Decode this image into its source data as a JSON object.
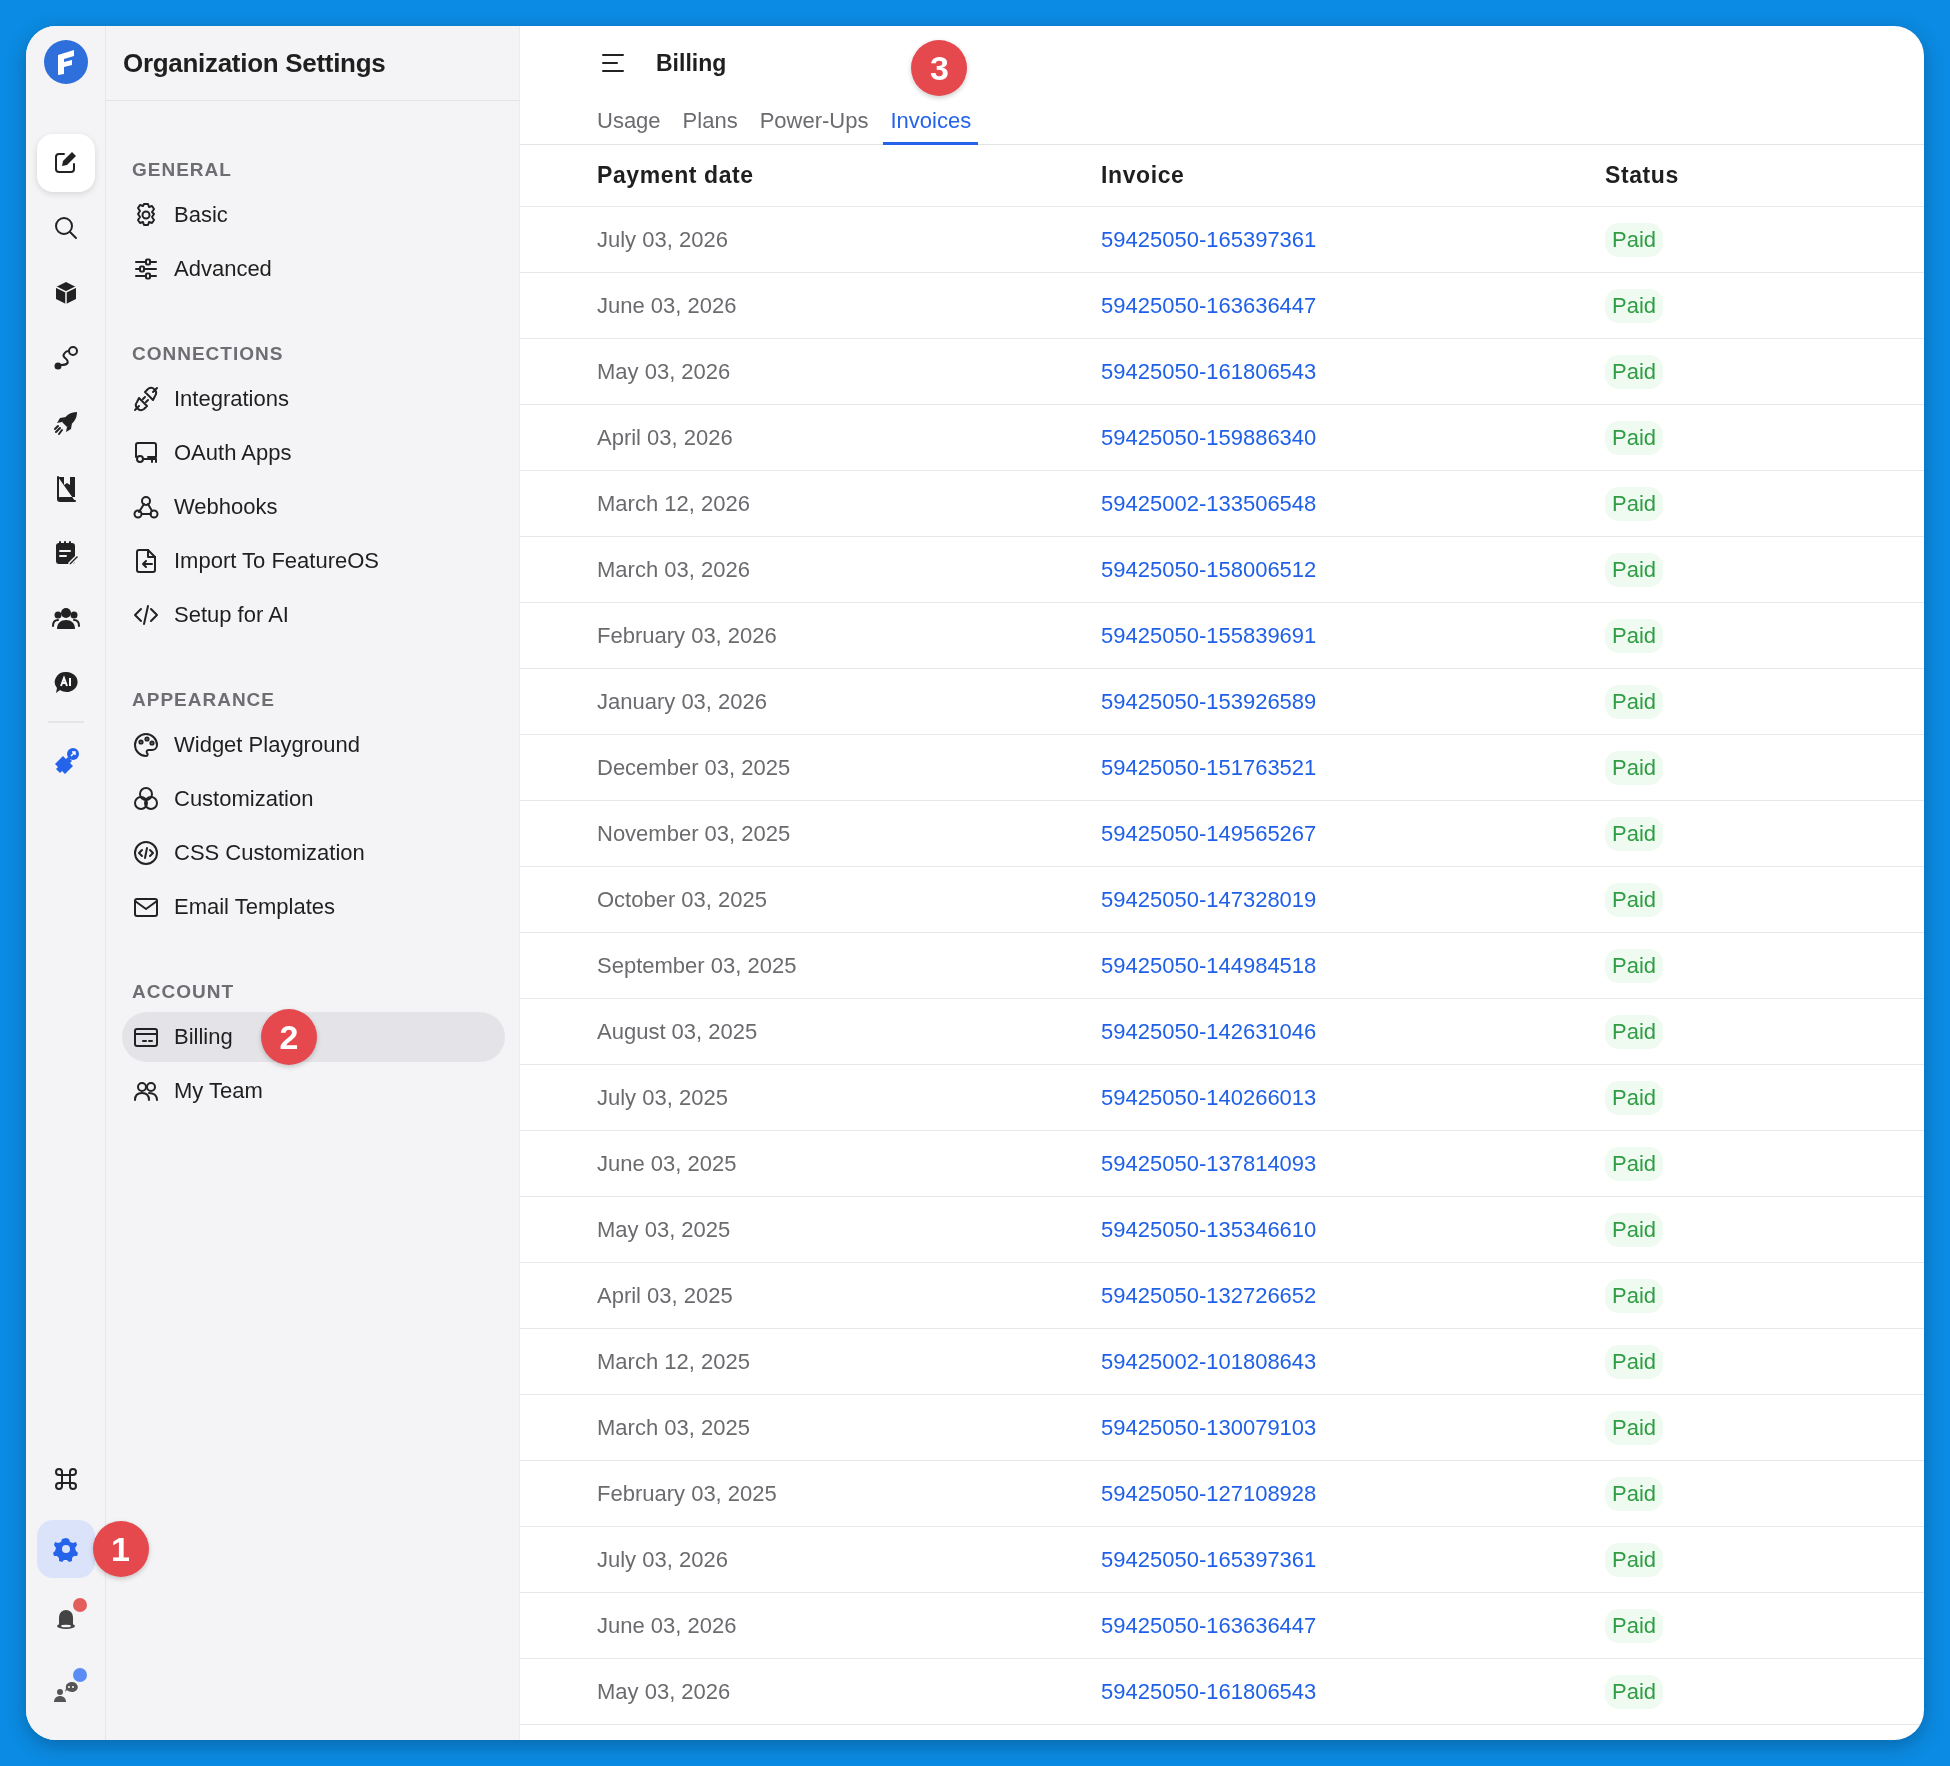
{
  "rail": {
    "top": [
      {
        "active": true,
        "selected": false
      },
      {
        "active": false,
        "selected": false
      },
      {
        "active": false,
        "selected": false
      },
      {
        "active": false,
        "selected": false
      },
      {
        "active": false,
        "selected": false
      },
      {
        "active": false,
        "selected": false
      },
      {
        "active": false,
        "selected": false
      },
      {
        "active": false,
        "selected": false
      },
      {
        "active": false,
        "selected": false
      }
    ],
    "bottom": [
      {
        "active": false,
        "selected": false
      },
      {
        "active": false,
        "selected": true,
        "marker": "1"
      },
      {
        "active": false,
        "selected": false,
        "color": "#e35d5d"
      },
      {
        "active": false,
        "selected": false,
        "color": "#5b8cf5"
      }
    ]
  },
  "sidebar": {
    "title": "Organization Settings",
    "sections": [
      {
        "heading": "GENERAL",
        "items": [
          {
            "label": "Basic",
            "selected": false
          },
          {
            "label": "Advanced",
            "selected": false
          }
        ]
      },
      {
        "heading": "CONNECTIONS",
        "items": [
          {
            "label": "Integrations",
            "selected": false
          },
          {
            "label": "OAuth Apps",
            "selected": false
          },
          {
            "label": "Webhooks",
            "selected": false
          },
          {
            "label": "Import To FeatureOS",
            "selected": false
          },
          {
            "label": "Setup for AI",
            "selected": false
          }
        ]
      },
      {
        "heading": "APPEARANCE",
        "items": [
          {
            "label": "Widget Playground",
            "selected": false
          },
          {
            "label": "Customization",
            "selected": false
          },
          {
            "label": "CSS Customization",
            "selected": false
          },
          {
            "label": "Email Templates",
            "selected": false
          }
        ]
      },
      {
        "heading": "ACCOUNT",
        "items": [
          {
            "label": "Billing",
            "selected": true,
            "marker": "2"
          },
          {
            "label": "My Team",
            "selected": false
          }
        ]
      }
    ]
  },
  "header": {
    "title": "Billing"
  },
  "tabs": [
    {
      "label": "Usage",
      "selected": false
    },
    {
      "label": "Plans",
      "selected": false
    },
    {
      "label": "Power-Ups",
      "selected": false
    },
    {
      "label": "Invoices",
      "selected": true,
      "marker": "3"
    }
  ],
  "table": {
    "columns": [
      "Payment date",
      "Invoice",
      "Status"
    ],
    "rows": [
      {
        "date": "July 03, 2026",
        "invoice": "59425050-165397361",
        "status": "Paid"
      },
      {
        "date": "June 03, 2026",
        "invoice": "59425050-163636447",
        "status": "Paid"
      },
      {
        "date": "May 03, 2026",
        "invoice": "59425050-161806543",
        "status": "Paid"
      },
      {
        "date": "April 03, 2026",
        "invoice": "59425050-159886340",
        "status": "Paid"
      },
      {
        "date": "March 12, 2026",
        "invoice": "59425002-133506548",
        "status": "Paid"
      },
      {
        "date": "March 03, 2026",
        "invoice": "59425050-158006512",
        "status": "Paid"
      },
      {
        "date": "February 03, 2026",
        "invoice": "59425050-155839691",
        "status": "Paid"
      },
      {
        "date": "January 03, 2026",
        "invoice": "59425050-153926589",
        "status": "Paid"
      },
      {
        "date": "December 03, 2025",
        "invoice": "59425050-151763521",
        "status": "Paid"
      },
      {
        "date": "November 03, 2025",
        "invoice": "59425050-149565267",
        "status": "Paid"
      },
      {
        "date": "October 03, 2025",
        "invoice": "59425050-147328019",
        "status": "Paid"
      },
      {
        "date": "September 03, 2025",
        "invoice": "59425050-144984518",
        "status": "Paid"
      },
      {
        "date": "August 03, 2025",
        "invoice": "59425050-142631046",
        "status": "Paid"
      },
      {
        "date": "July 03, 2025",
        "invoice": "59425050-140266013",
        "status": "Paid"
      },
      {
        "date": "June 03, 2025",
        "invoice": "59425050-137814093",
        "status": "Paid"
      },
      {
        "date": "May 03, 2025",
        "invoice": "59425050-135346610",
        "status": "Paid"
      },
      {
        "date": "April 03, 2025",
        "invoice": "59425050-132726652",
        "status": "Paid"
      },
      {
        "date": "March 12, 2025",
        "invoice": "59425002-101808643",
        "status": "Paid"
      },
      {
        "date": "March 03, 2025",
        "invoice": "59425050-130079103",
        "status": "Paid"
      },
      {
        "date": "February 03, 2025",
        "invoice": "59425050-127108928",
        "status": "Paid"
      },
      {
        "date": "July 03, 2026",
        "invoice": "59425050-165397361",
        "status": "Paid"
      },
      {
        "date": "June 03, 2026",
        "invoice": "59425050-163636447",
        "status": "Paid"
      },
      {
        "date": "May 03, 2026",
        "invoice": "59425050-161806543",
        "status": "Paid"
      }
    ]
  }
}
